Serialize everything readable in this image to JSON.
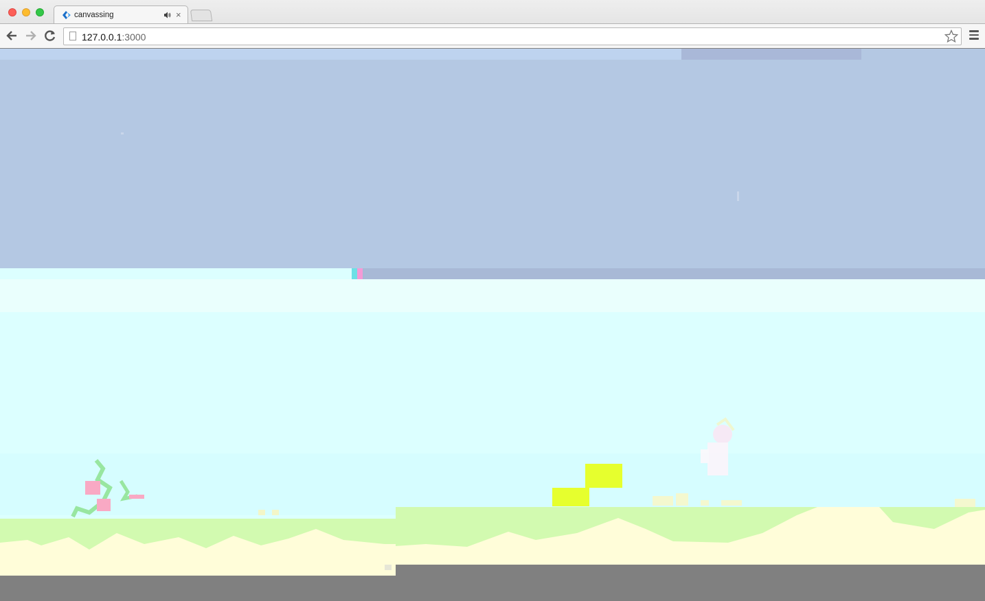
{
  "browser": {
    "tab_title": "canvassing",
    "tab_audio_icon": "speaker-icon",
    "tab_close_glyph": "×",
    "url_host": "127.0.0.1",
    "url_port": ":3000",
    "icons": {
      "back": "back-arrow-icon",
      "forward": "forward-arrow-icon",
      "reload": "reload-icon",
      "star": "bookmark-star-icon",
      "menu": "hamburger-menu-icon"
    }
  },
  "game": {
    "colors": {
      "sky_upper": "#b4c8e3",
      "sky_lower": "#dcffff",
      "grass": "#d2fab0",
      "sand": "#fffdd9",
      "block": "#e6ff2e",
      "flower": "#f9a9c4",
      "background": "#808080"
    }
  }
}
